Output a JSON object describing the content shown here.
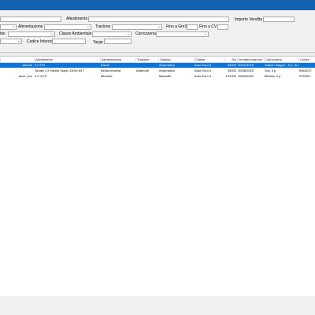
{
  "filters": {
    "allestimento_label": "Allestimento",
    "importo_vendita_label": "Importo Vendita",
    "alimentazione_label": "Alimentazione",
    "trazione_label": "Trazione",
    "fino_a_gm3_label": "Fino a Gm3",
    "fino_a_cv_label": "Fino a CV",
    "cambio_label": "bio",
    "classe_ambientale_label": "Classe Ambientale",
    "carrozzeria_label": "Carrozzeria",
    "codice_interno_label": "Codice Interno",
    "targa_label": "Targa"
  },
  "grid": {
    "columns": [
      "Allestimento",
      "Alimentazione",
      "Trazione",
      "Cambio",
      "Classe",
      "Kw",
      "Immatricolazione",
      "Carrozzeria",
      "Colore"
    ],
    "rows": [
      {
        "lead": "- Allroad",
        "allestimento": "2.0 TDI",
        "alimentazione": "Diesel",
        "trazione": "",
        "cambio": "Automatico",
        "classe": "Auto Euro 5",
        "kw": "45000",
        "immatricolazione": "30/01/2015",
        "carrozzeria": "Station Wagon - 5 p. Gu",
        "colore": ""
      },
      {
        "lead": "",
        "allestimento": "Tonale 1.5 Hybrid Super 130cv tct 7",
        "alimentazione": "Ibrida benzina",
        "trazione": "Anteriore",
        "cambio": "Automatico",
        "classe": "Auto Euro 6",
        "kw": "45000",
        "immatricolazione": "20/08/2023",
        "carrozzeria": "Suv, 5 p.",
        "colore": "BIANCO"
      },
      {
        "lead": "ance ) s/x",
        "allestimento": "1.0 VVTi",
        "alimentazione": "Benzina",
        "trazione": "",
        "cambio": "Manuale",
        "classe": "Auto Euro 3",
        "kw": "101000",
        "immatricolazione": "19/03/2002",
        "carrozzeria": "Berlina, 5 p.",
        "colore": "ROSSO"
      }
    ]
  },
  "colors": {
    "titlebar": "#1562b3",
    "selected_row": "#0a74da"
  }
}
